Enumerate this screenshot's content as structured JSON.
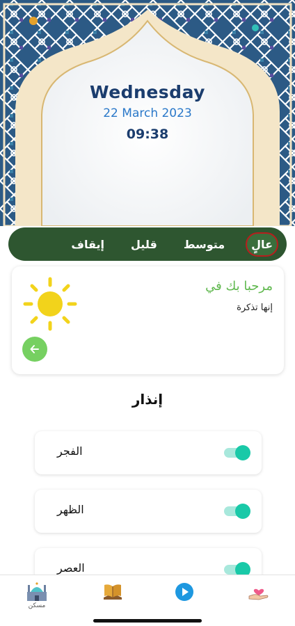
{
  "header": {
    "weekday": "Wednesday",
    "date": "22 March 2023",
    "time": "09:38"
  },
  "levels": {
    "options": [
      "عالٍ",
      "متوسط",
      "قليل",
      "إيقاف"
    ],
    "selected": "عالٍ"
  },
  "welcome_card": {
    "title": "مرحبا بك في",
    "subtitle": "إنها تذكرة",
    "icon": "sun-icon",
    "back_icon": "arrow-left-icon"
  },
  "warning": {
    "title": "إنذار",
    "prayers": [
      {
        "label": "الفجر",
        "enabled": true
      },
      {
        "label": "الظهر",
        "enabled": true
      },
      {
        "label": "العصر",
        "enabled": true
      }
    ]
  },
  "bottom_nav": {
    "items": [
      {
        "label": "مسكن",
        "icon": "mosque-home-icon"
      },
      {
        "label": "",
        "icon": "quran-book-icon"
      },
      {
        "label": "",
        "icon": "play-icon"
      },
      {
        "label": "",
        "icon": "charity-hand-heart-icon"
      }
    ]
  },
  "colors": {
    "accent_green": "#2e5630",
    "welcome_green": "#5fb84e",
    "toggle_teal": "#19c9a8",
    "date_blue": "#2a78c9",
    "title_navy": "#1b3d6e"
  }
}
